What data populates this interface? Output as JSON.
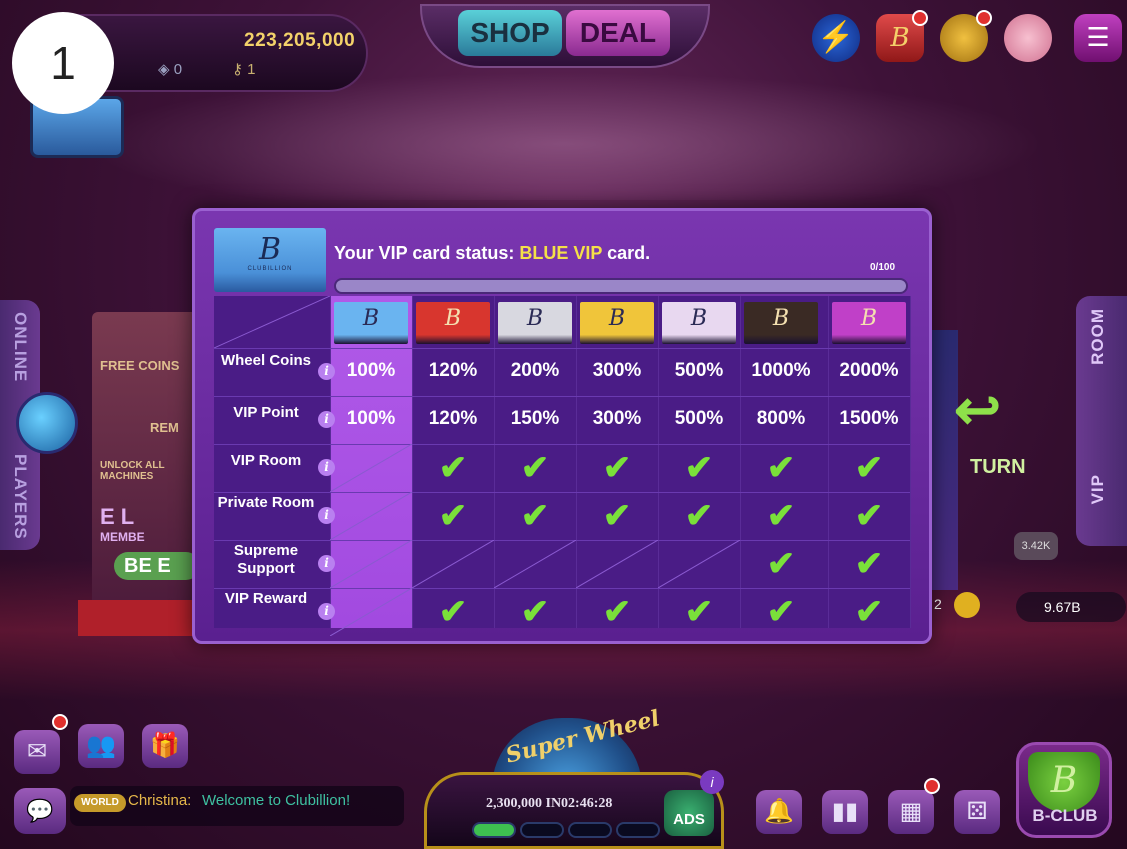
{
  "top_bar": {
    "badge_number": "1",
    "coins": "223,205,000",
    "stat_a": "0",
    "stat_b": "1",
    "shop_label": "SHOP",
    "deal_label": "DEAL",
    "menu_glyph": "☰"
  },
  "side": {
    "online_label": "ONLINE",
    "players_label": "PLAYERS",
    "room_label": "ROOM",
    "vip_label": "VIP"
  },
  "background": {
    "free_coins": "FREE COINS",
    "rem": "REM",
    "unlock": "UNLOCK ALL MACHINES",
    "elite": "E L",
    "member": "MEMBE",
    "be": "BE E",
    "turn": "TURN",
    "heart_count": "3.42K",
    "right_balance": "9.67B",
    "right_small": "2"
  },
  "dialog": {
    "status_prefix": "Your VIP card status: ",
    "status_highlight": "BLUE VIP",
    "status_suffix": " card.",
    "progress_text": "0/100",
    "card_logo": "B",
    "card_sub": "CLUBILLION",
    "tiers": [
      {
        "name": "blue",
        "color": "#6ab4f0",
        "logo": "B"
      },
      {
        "name": "red",
        "color": "#d8362e",
        "logo": "B"
      },
      {
        "name": "silver",
        "color": "#d8d8e0",
        "logo": "B"
      },
      {
        "name": "gold",
        "color": "#f0c53a",
        "logo": "B"
      },
      {
        "name": "diamond",
        "color": "#e8d8f0",
        "logo": "B"
      },
      {
        "name": "black",
        "color": "#3a2a24",
        "logo": "B"
      },
      {
        "name": "purple",
        "color": "#c040c8",
        "logo": "B"
      }
    ],
    "rows": [
      {
        "label": "Wheel Coins",
        "values": [
          "100%",
          "120%",
          "200%",
          "300%",
          "500%",
          "1000%",
          "2000%"
        ]
      },
      {
        "label": "VIP Point",
        "values": [
          "100%",
          "120%",
          "150%",
          "300%",
          "500%",
          "800%",
          "1500%"
        ]
      },
      {
        "label": "VIP Room",
        "values": [
          false,
          true,
          true,
          true,
          true,
          true,
          true
        ]
      },
      {
        "label": "Private Room",
        "values": [
          false,
          true,
          true,
          true,
          true,
          true,
          true
        ]
      },
      {
        "label": "Supreme Support",
        "values": [
          false,
          false,
          false,
          false,
          false,
          true,
          true
        ]
      },
      {
        "label": "VIP Reward",
        "values": [
          false,
          true,
          true,
          true,
          true,
          true,
          true
        ]
      }
    ],
    "info_glyph": "i",
    "check_glyph": "✔"
  },
  "bottom_bar": {
    "world_tag": "WORLD",
    "chat_name": "Christina:",
    "chat_msg": "Welcome to Clubillion!",
    "super_wheel": "Super Wheel",
    "wheel_coins": "2,300,000",
    "wheel_timer": "IN02:46:28",
    "ads_label": "ADS",
    "bclub_label": "B-CLUB",
    "bclub_logo": "B",
    "wheel_progress_filled": 1,
    "wheel_progress_total": 4
  },
  "colors": {
    "accent_yellow": "#f4e048",
    "check_green": "#7ae03a",
    "dialog_purple": "#7a36b0",
    "coins_gold": "#f3d26a"
  },
  "icons": [
    "bolt-icon",
    "vip-card-icon",
    "bear-icon",
    "piggy-bank-icon",
    "menu-icon",
    "mail-icon",
    "friends-icon",
    "gift-icon",
    "chat-icon",
    "bell-icon",
    "leaderboard-icon",
    "calendar-icon",
    "dice-icon",
    "globe-icon",
    "turn-arrow-icon"
  ]
}
